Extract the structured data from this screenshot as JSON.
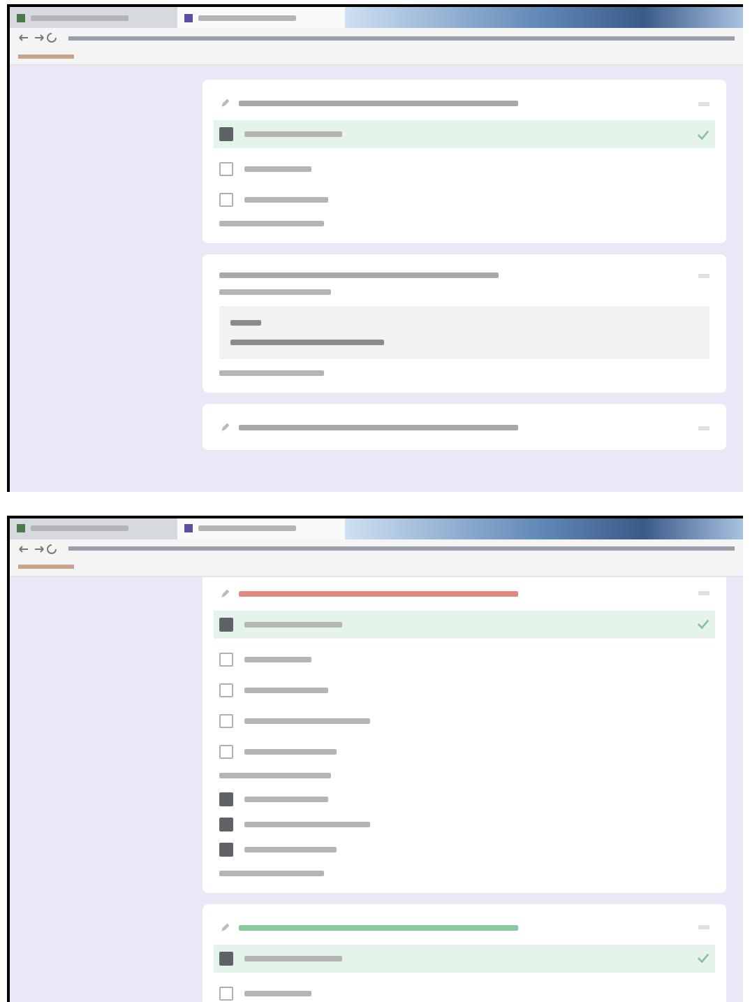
{
  "screenshots": [
    {
      "tabs": [
        {
          "selected": false
        },
        {
          "selected": true
        }
      ],
      "cards": [
        {
          "kind": "choice",
          "color": "#a9a9a9",
          "options": [
            {
              "checked": true,
              "highlighted": true
            },
            {
              "checked": false,
              "highlighted": false
            },
            {
              "checked": false,
              "highlighted": false
            }
          ],
          "feedback": true
        },
        {
          "kind": "text",
          "color": "#a9a9a9",
          "feedback": true
        },
        {
          "kind": "choice",
          "color": "#a9a9a9"
        }
      ]
    },
    {
      "tabs": [
        {
          "selected": false
        },
        {
          "selected": true
        }
      ],
      "cards": [
        {
          "kind": "choice",
          "color": "#e08a86",
          "options": [
            {
              "checked": true,
              "highlighted": true
            },
            {
              "checked": false,
              "highlighted": false
            },
            {
              "checked": false,
              "highlighted": false
            },
            {
              "checked": false,
              "highlighted": false
            },
            {
              "checked": false,
              "highlighted": false
            }
          ],
          "correct_answers": [
            {
              "checked": true
            },
            {
              "checked": true
            },
            {
              "checked": true
            }
          ],
          "feedback": true
        },
        {
          "kind": "choice",
          "color": "#8cc79c",
          "options": [
            {
              "checked": true,
              "highlighted": true
            },
            {
              "checked": false,
              "highlighted": false
            }
          ]
        }
      ]
    }
  ]
}
